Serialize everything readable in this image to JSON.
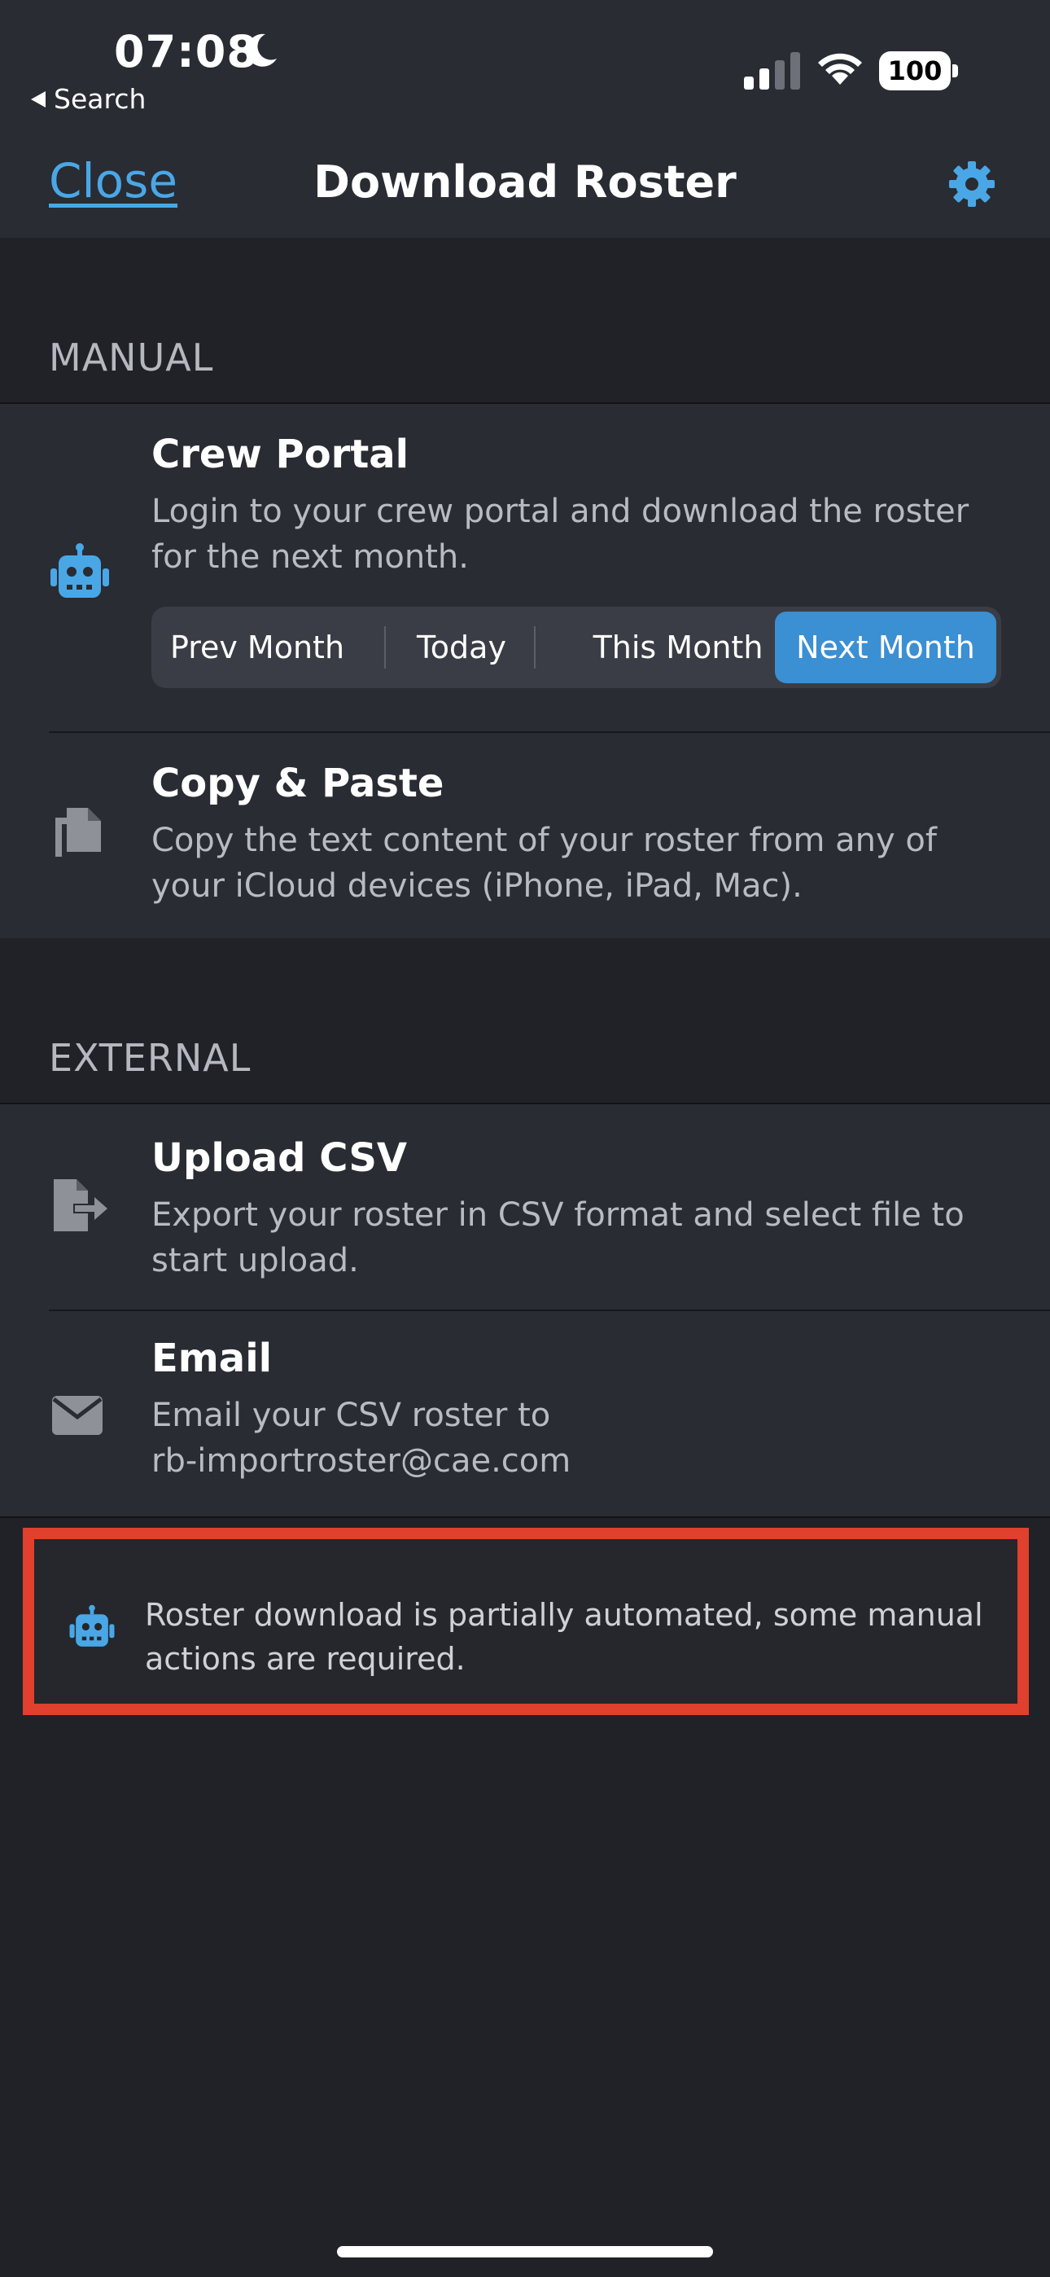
{
  "status_bar": {
    "time": "07:08",
    "back_label": "Search",
    "battery": "100"
  },
  "nav": {
    "close_label": "Close",
    "title": "Download Roster"
  },
  "sections": {
    "manual": {
      "header": "MANUAL",
      "crew_portal": {
        "title": "Crew Portal",
        "description": "Login to your crew portal and download the roster for the next month.",
        "segments": [
          "Prev Month",
          "Today",
          "This Month",
          "Next Month"
        ],
        "selected_segment": "Next Month"
      },
      "copy_paste": {
        "title": "Copy & Paste",
        "description": "Copy the text content of your roster from any of your iCloud devices (iPhone, iPad, Mac)."
      }
    },
    "external": {
      "header": "EXTERNAL",
      "upload_csv": {
        "title": "Upload CSV",
        "description": "Export your roster in CSV format and select file to start upload."
      },
      "email": {
        "title": "Email",
        "description_line1": "Email your CSV roster to",
        "description_line2": "rb-importroster@cae.com"
      }
    }
  },
  "info_banner": {
    "text": "Roster download is partially automated, some manual actions are required."
  },
  "colors": {
    "accent": "#4aa7e6",
    "segment_active": "#3b8fd3",
    "highlight_border": "#e0402d",
    "background": "#202227",
    "cell_background": "#292c33"
  },
  "icons": {
    "moon": "moon-icon",
    "gear": "gear-icon",
    "robot": "robot-icon",
    "copy": "copy-icon",
    "file_export": "file-export-icon",
    "envelope": "envelope-icon"
  }
}
